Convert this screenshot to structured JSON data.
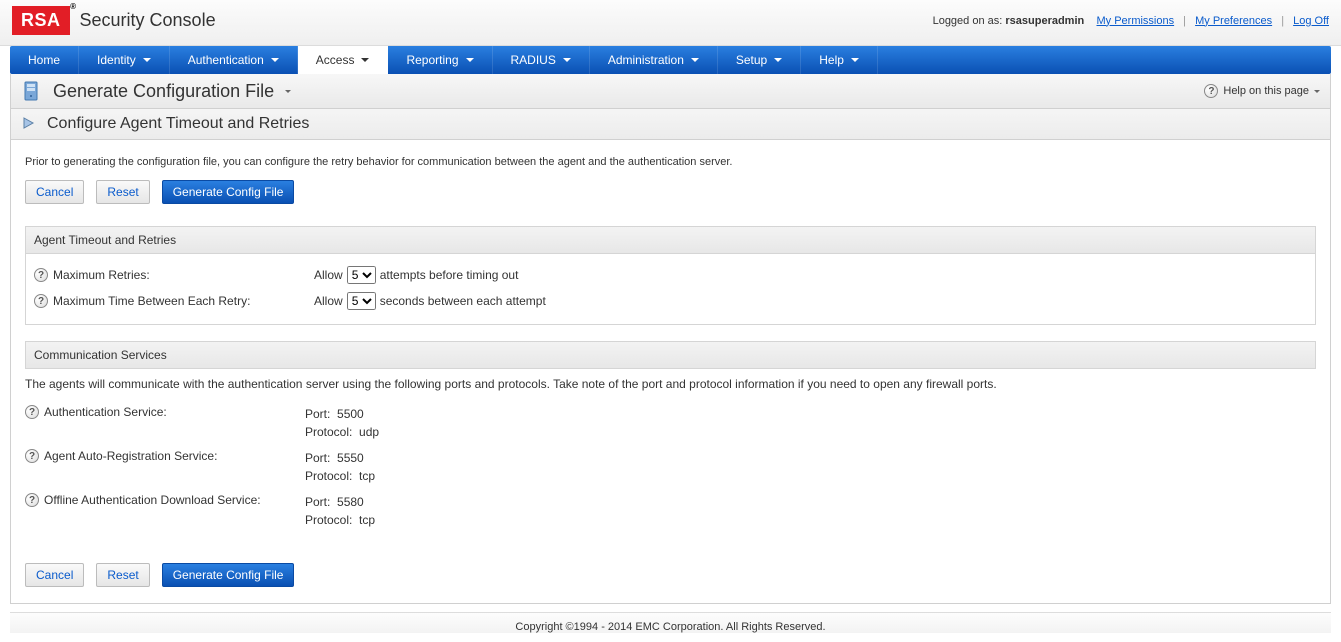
{
  "header": {
    "logo_text": "RSA",
    "title": "Security Console",
    "logged_on_prefix": "Logged on as: ",
    "user": "rsasuperadmin",
    "link_permissions": "My Permissions",
    "link_preferences": "My Preferences",
    "link_logoff": "Log Off"
  },
  "nav": {
    "items": [
      {
        "label": "Home",
        "has_dropdown": false,
        "active": false
      },
      {
        "label": "Identity",
        "has_dropdown": true,
        "active": false
      },
      {
        "label": "Authentication",
        "has_dropdown": true,
        "active": false
      },
      {
        "label": "Access",
        "has_dropdown": true,
        "active": true
      },
      {
        "label": "Reporting",
        "has_dropdown": true,
        "active": false
      },
      {
        "label": "RADIUS",
        "has_dropdown": true,
        "active": false
      },
      {
        "label": "Administration",
        "has_dropdown": true,
        "active": false
      },
      {
        "label": "Setup",
        "has_dropdown": true,
        "active": false
      },
      {
        "label": "Help",
        "has_dropdown": true,
        "active": false
      }
    ]
  },
  "page": {
    "title": "Generate Configuration File",
    "help_label": "Help on this page",
    "sub_title": "Configure Agent Timeout and Retries",
    "intro": "Prior to generating the configuration file, you can configure the retry behavior for communication between the agent and the authentication server."
  },
  "buttons": {
    "cancel": "Cancel",
    "reset": "Reset",
    "generate": "Generate Config File"
  },
  "sections": {
    "timeout": {
      "heading": "Agent Timeout and Retries",
      "max_retries_label": "Maximum Retries:",
      "max_retries_prefix": "Allow",
      "max_retries_value": "5",
      "max_retries_suffix": "attempts before timing out",
      "max_time_label": "Maximum Time Between Each Retry:",
      "max_time_prefix": "Allow",
      "max_time_value": "5",
      "max_time_suffix": "seconds between each attempt"
    },
    "comm": {
      "heading": "Communication Services",
      "desc": "The agents will communicate with the authentication server using the following ports and protocols. Take note of the port and protocol information if you need to open any firewall ports.",
      "services": [
        {
          "label": "Authentication Service:",
          "port": "5500",
          "protocol": "udp"
        },
        {
          "label": "Agent Auto-Registration Service:",
          "port": "5550",
          "protocol": "tcp"
        },
        {
          "label": "Offline Authentication Download Service:",
          "port": "5580",
          "protocol": "tcp"
        }
      ],
      "port_label": "Port:",
      "protocol_label": "Protocol:"
    }
  },
  "footer": {
    "copyright": "Copyright ©1994 - 2014 EMC Corporation. All Rights Reserved."
  }
}
